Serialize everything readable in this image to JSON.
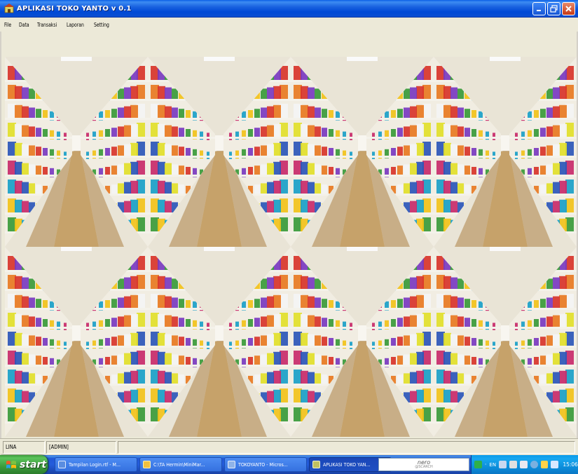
{
  "window": {
    "title": "APLIKASI TOKO YANTO v 0.1",
    "icon": "app-shop-icon",
    "controls": [
      "minimize-icon",
      "maximize-icon",
      "close-icon"
    ]
  },
  "menu": {
    "items": [
      {
        "label": "File"
      },
      {
        "label": "Data"
      },
      {
        "label": "Transaksi"
      },
      {
        "label": "Laporan"
      },
      {
        "label": "Setting"
      }
    ]
  },
  "main": {
    "background": "supermarket-aisle-wallpaper (tiled 4x2)"
  },
  "statusbar": {
    "user": "LINA",
    "role": "[ADMIN]"
  },
  "taskbar": {
    "start_label": "start",
    "tasks": [
      {
        "label": "Tampilan Login.rtf - M...",
        "icon": "wordpad-icon",
        "icon_color": "#5a8de0"
      },
      {
        "label": "C:\\TA Hermin\\MiniMar...",
        "icon": "folder-icon",
        "icon_color": "#f0c040"
      },
      {
        "label": "TOKOYANTO - Micros...",
        "icon": "vb-icon",
        "icon_color": "#8fb3e8"
      },
      {
        "label": "APLIKASI TOKO YAN...",
        "icon": "app-shop-icon",
        "icon_color": "#c0c060",
        "active": true
      }
    ],
    "nero": {
      "line1": "nero",
      "line2": "@SCARCH"
    },
    "tray": {
      "language": "EN",
      "time": "15:06"
    }
  },
  "colors": {
    "titlebar": "#0a58d8",
    "menubar": "#ece9d8",
    "taskbar": "#245ddb",
    "start": "#3c9c3c",
    "tray": "#0b8ad8"
  }
}
